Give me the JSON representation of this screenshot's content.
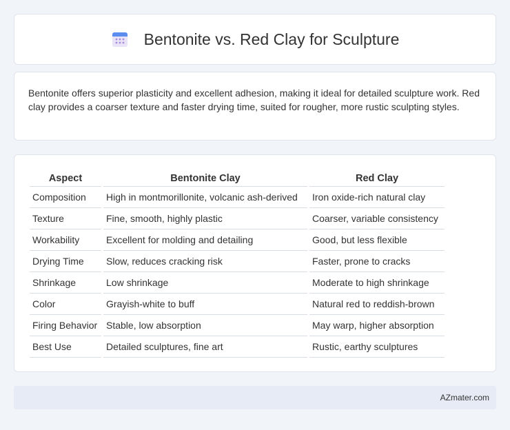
{
  "header": {
    "title": "Bentonite vs. Red Clay for Sculpture",
    "icon": "calendar-icon"
  },
  "summary": {
    "text": "Bentonite offers superior plasticity and excellent adhesion, making it ideal for detailed sculpture work. Red clay provides a coarser texture and faster drying time, suited for rougher, more rustic sculpting styles."
  },
  "table": {
    "headers": [
      "Aspect",
      "Bentonite Clay",
      "Red Clay"
    ],
    "rows": [
      [
        "Composition",
        "High in montmorillonite, volcanic ash-derived",
        "Iron oxide-rich natural clay"
      ],
      [
        "Texture",
        "Fine, smooth, highly plastic",
        "Coarser, variable consistency"
      ],
      [
        "Workability",
        "Excellent for molding and detailing",
        "Good, but less flexible"
      ],
      [
        "Drying Time",
        "Slow, reduces cracking risk",
        "Faster, prone to cracks"
      ],
      [
        "Shrinkage",
        "Low shrinkage",
        "Moderate to high shrinkage"
      ],
      [
        "Color",
        "Grayish-white to buff",
        "Natural red to reddish-brown"
      ],
      [
        "Firing Behavior",
        "Stable, low absorption",
        "May warp, higher absorption"
      ],
      [
        "Best Use",
        "Detailed sculptures, fine art",
        "Rustic, earthy sculptures"
      ]
    ]
  },
  "footer": {
    "brand": "AZmater.com"
  },
  "colors": {
    "background": "#f1f4f9",
    "icon_blue": "#5b8dee",
    "icon_purple": "#a78bdb",
    "footer_bg": "#e6ebf5"
  }
}
